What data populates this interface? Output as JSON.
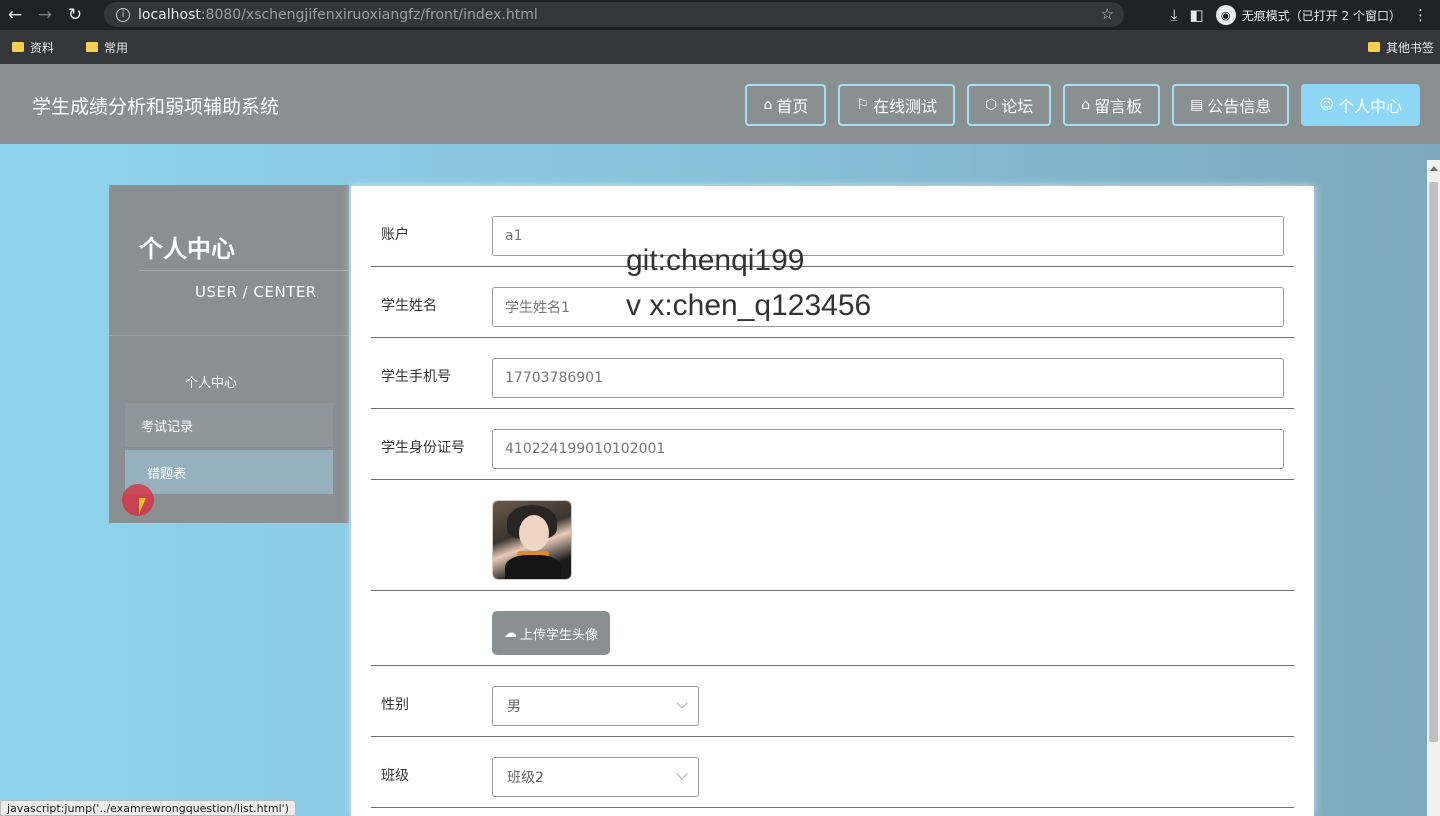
{
  "browser": {
    "url_host": "localhost",
    "url_path": ":8080/xschengjifenxiruoxiangfz/front/index.html",
    "incognito_label": "无痕模式（已打开 2 个窗口）",
    "bookmarks": [
      "资料",
      "常用"
    ],
    "other_bookmarks": "其他书签",
    "status_text": "javascript:jump('../examrewrongquestion/list.html')"
  },
  "header": {
    "title": "学生成绩分析和弱项辅助系统",
    "nav": [
      {
        "label": "首页",
        "icon": "⌂"
      },
      {
        "label": "在线测试",
        "icon": "⚐"
      },
      {
        "label": "论坛",
        "icon": "⬡"
      },
      {
        "label": "留言板",
        "icon": "⌂"
      },
      {
        "label": "公告信息",
        "icon": "▤"
      },
      {
        "label": "个人中心",
        "icon": "☺"
      }
    ]
  },
  "sidebar": {
    "title": "个人中心",
    "subtitle": "USER / CENTER",
    "heading": "个人中心",
    "items": [
      "考试记录",
      "错题表"
    ]
  },
  "form": {
    "account_label": "账户",
    "account_value": "a1",
    "name_label": "学生姓名",
    "name_value": "学生姓名1",
    "phone_label": "学生手机号",
    "phone_value": "17703786901",
    "idcard_label": "学生身份证号",
    "idcard_value": "410224199010102001",
    "upload_label": "上传学生头像",
    "gender_label": "性别",
    "gender_value": "男",
    "class_label": "班级",
    "class_value": "班级2"
  },
  "watermark": {
    "line1": "git:chenqi199",
    "line2": "v x:chen_q123456"
  },
  "colors": {
    "header_bg": "#8a9092",
    "accent": "#8fd7f7",
    "page_bg": "#8fc9e3"
  }
}
